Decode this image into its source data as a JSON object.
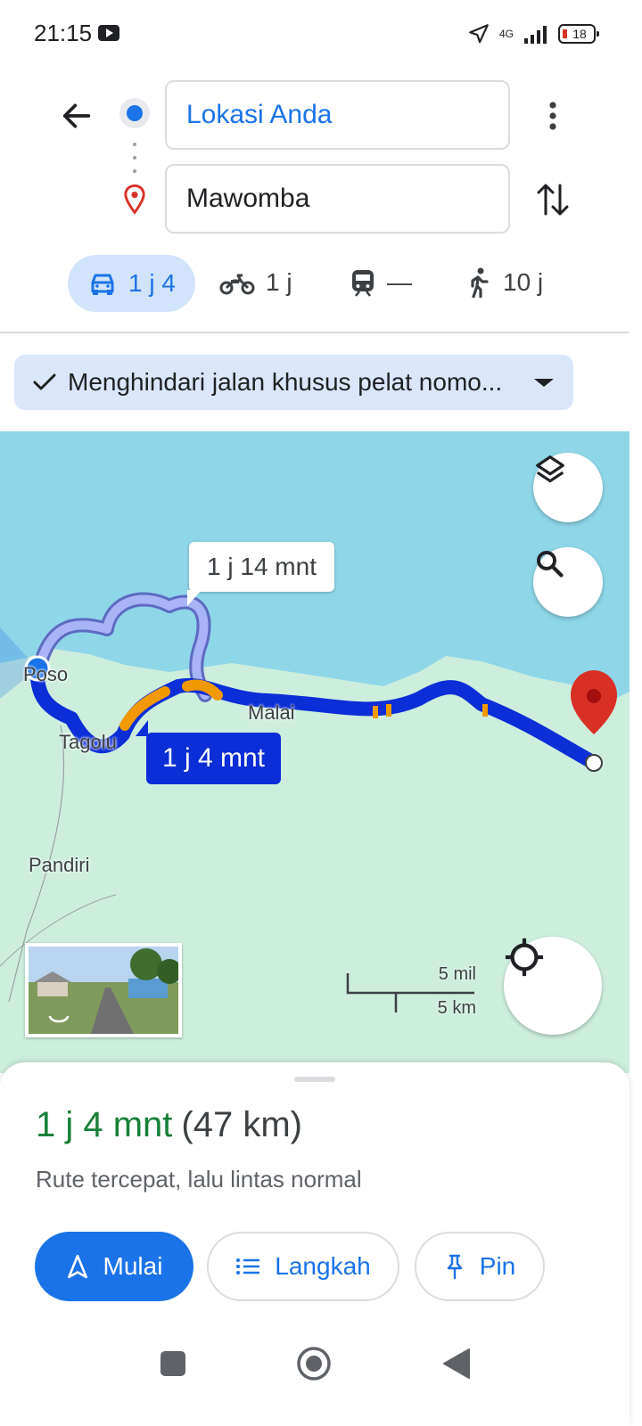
{
  "status_bar": {
    "time": "21:15",
    "network": "4G",
    "battery": "18"
  },
  "search": {
    "origin": "Lokasi Anda",
    "destination": "Mawomba"
  },
  "modes": [
    {
      "name": "car",
      "label": "1 j 4",
      "active": true
    },
    {
      "name": "motorcycle",
      "label": "1 j",
      "active": false
    },
    {
      "name": "transit",
      "label": "—",
      "active": false
    },
    {
      "name": "walk",
      "label": "10 j",
      "active": false
    }
  ],
  "route_option": {
    "label": "Menghindari jalan khusus pelat nomo..."
  },
  "map": {
    "labels": {
      "poso": "Poso",
      "tagolu": "Tagolu",
      "malai": "Malai",
      "pandiri": "Pandiri"
    },
    "alt_route_time": "1 j 14 mnt",
    "main_route_time": "1 j 4 mnt",
    "scale_miles": "5 mil",
    "scale_km": "5 km",
    "colors": {
      "water": "#8fd6e9",
      "land": "#cdeedd",
      "route": "#0b2ed6",
      "alt_route": "#a8b4f5",
      "traffic": "#f29900",
      "pin": "#d93025"
    }
  },
  "sheet": {
    "duration": "1 j 4 mnt",
    "distance": "(47 km)",
    "subtitle": "Rute tercepat, lalu lintas normal",
    "buttons": {
      "start": "Mulai",
      "steps": "Langkah",
      "pin": "Pin"
    }
  }
}
